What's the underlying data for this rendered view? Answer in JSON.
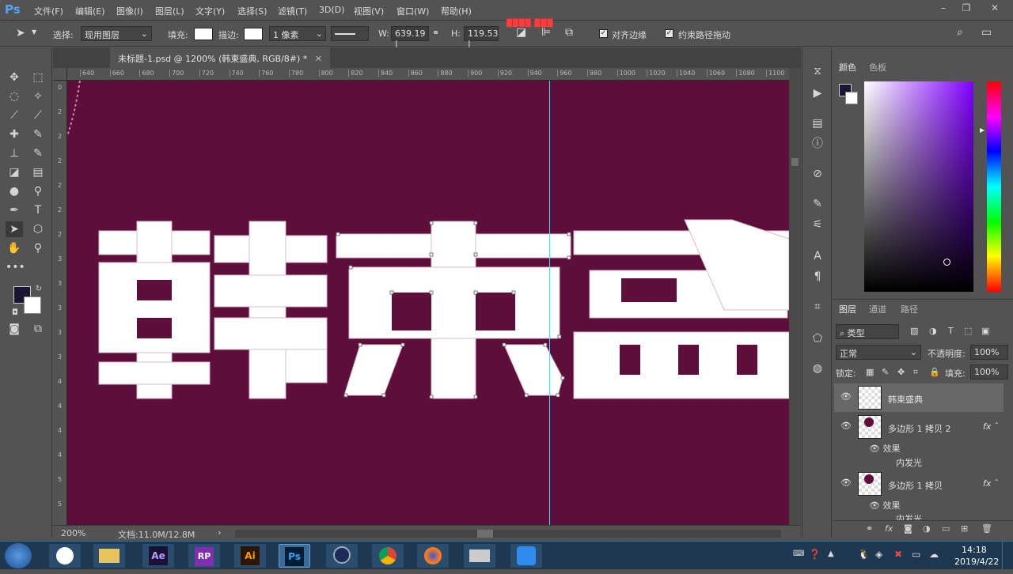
{
  "app": {
    "logo": "Ps"
  },
  "menu": [
    "文件(F)",
    "编辑(E)",
    "图像(I)",
    "图层(L)",
    "文字(Y)",
    "选择(S)",
    "滤镜(T)",
    "3D(D)",
    "视图(V)",
    "窗口(W)",
    "帮助(H)"
  ],
  "options": {
    "select_label": "选择:",
    "select_value": "现用图层",
    "fill_label": "填充:",
    "stroke_label": "描边:",
    "stroke_width": "1 像素",
    "w_label": "W:",
    "w_value": "639.19 |",
    "h_label": "H:",
    "h_value": "119.53 |",
    "align_edges": "对齐边缘",
    "constrain_path": "约束路径拖动"
  },
  "document": {
    "tab_title": "未标题-1.psd @ 1200% (韩東盛典, RGB/8#) *",
    "canvas_color": "#5e0e3b",
    "canvas_text": "韩東盛",
    "zoom": "200%",
    "doc_info": "文档:11.0M/12.8M"
  },
  "ruler_top": [
    "640",
    "660",
    "680",
    "700",
    "720",
    "740",
    "760",
    "780",
    "800",
    "820",
    "840",
    "860",
    "880",
    "900",
    "920",
    "940",
    "960",
    "980",
    "1000",
    "1020",
    "1040",
    "1060",
    "1080",
    "1100"
  ],
  "ruler_left": [
    "0",
    "2",
    "2",
    "2",
    "2",
    "2",
    "2",
    "3",
    "3",
    "3",
    "3",
    "3",
    "4",
    "4",
    "4",
    "4",
    "5",
    "5"
  ],
  "panels": {
    "color_tab": "颜色",
    "swatches_tab": "色板",
    "layers_tab": "图层",
    "channels_tab": "通道",
    "paths_tab": "路径",
    "filter_kind": "类型",
    "blend_mode": "正常",
    "opacity_label": "不透明度:",
    "opacity_value": "100%",
    "lock_label": "锁定:",
    "fill_label": "填充:",
    "fill_value": "100%"
  },
  "layers": [
    {
      "name": "韩東盛典"
    },
    {
      "name": "多边形 1 拷贝 2",
      "effects": "效果",
      "effect": "内发光"
    },
    {
      "name": "多边形 1 拷贝",
      "effects": "效果",
      "effect": "内发光"
    }
  ],
  "taskbar": {
    "apps": [
      "Ae",
      "RP",
      "Ai",
      "Ps"
    ],
    "time": "14:18",
    "date": "2019/4/22"
  }
}
